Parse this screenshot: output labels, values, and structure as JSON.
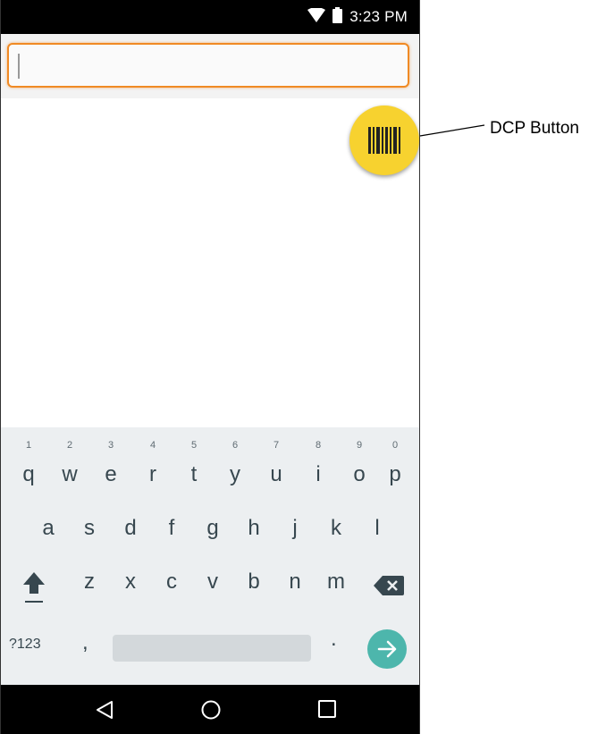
{
  "status_bar": {
    "time": "3:23 PM",
    "icons": [
      "wifi-icon",
      "battery-icon"
    ]
  },
  "search": {
    "value": "",
    "placeholder": "",
    "accent_color": "#f08a24"
  },
  "dcp": {
    "icon": "barcode-icon",
    "color": "#f7d22f",
    "callout_label": "DCP Button"
  },
  "keyboard": {
    "row1": [
      {
        "label": "q",
        "hint": "1"
      },
      {
        "label": "w",
        "hint": "2"
      },
      {
        "label": "e",
        "hint": "3"
      },
      {
        "label": "r",
        "hint": "4"
      },
      {
        "label": "t",
        "hint": "5"
      },
      {
        "label": "y",
        "hint": "6"
      },
      {
        "label": "u",
        "hint": "7"
      },
      {
        "label": "i",
        "hint": "8"
      },
      {
        "label": "o",
        "hint": "9"
      },
      {
        "label": "p",
        "hint": "0"
      }
    ],
    "row2": [
      "a",
      "s",
      "d",
      "f",
      "g",
      "h",
      "j",
      "k",
      "l"
    ],
    "row3": [
      "z",
      "x",
      "c",
      "v",
      "b",
      "n",
      "m"
    ],
    "symbols_label": "?123",
    "comma_label": ",",
    "period_label": ".",
    "shift_icon": "shift-icon",
    "backspace_icon": "backspace-icon",
    "enter_icon": "arrow-right-icon",
    "enter_color": "#4db6ac"
  },
  "nav_bar": {
    "icons": [
      "back-icon",
      "home-icon",
      "recents-icon"
    ]
  }
}
